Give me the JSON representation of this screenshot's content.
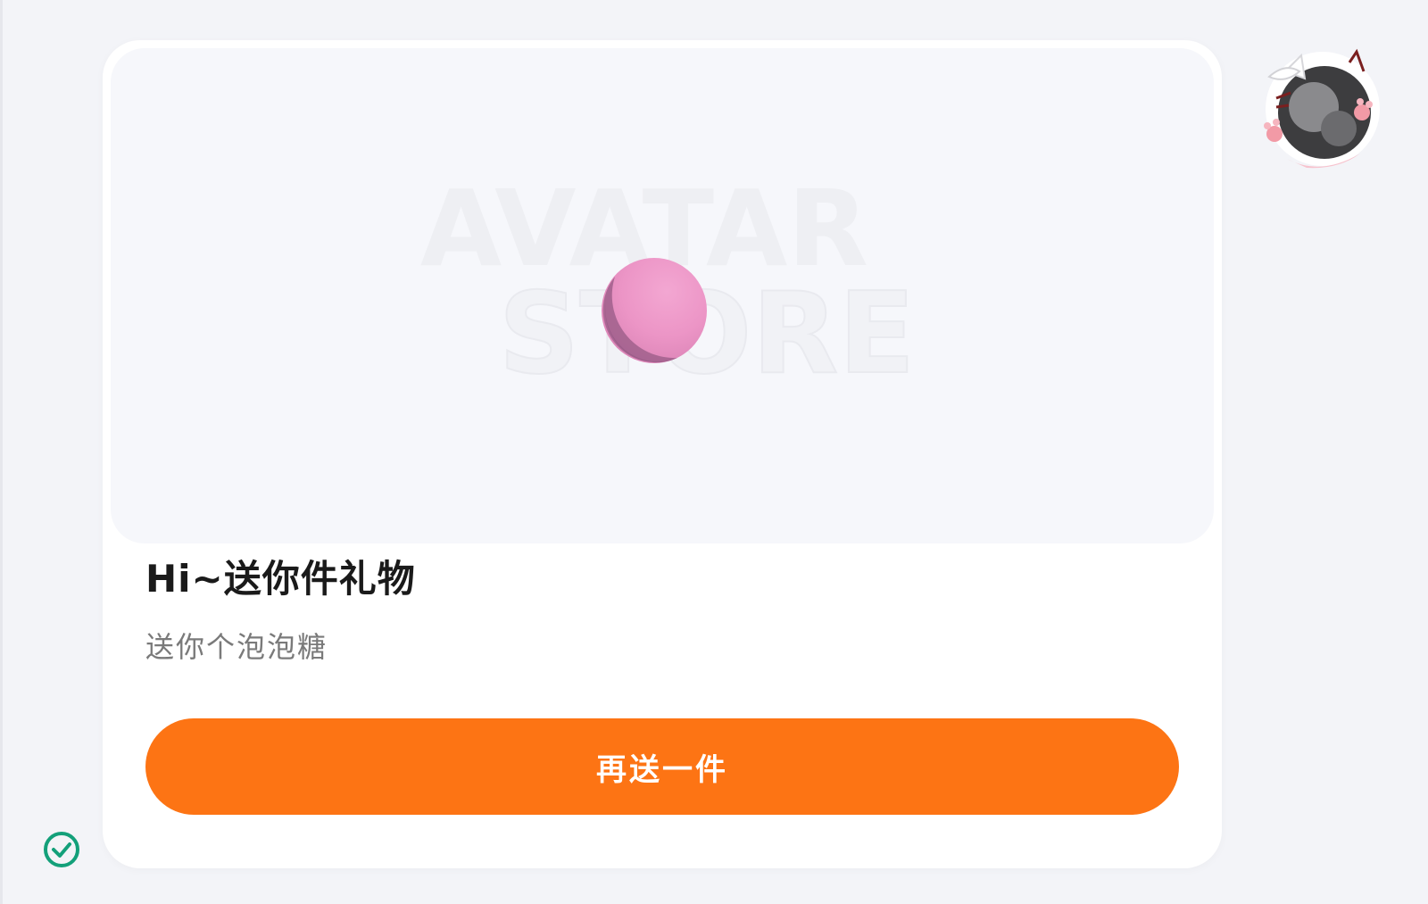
{
  "preview": {
    "watermark_line1": "AVATAR",
    "watermark_line2": "STORE",
    "gift_icon": "bubble-gum-ball-icon"
  },
  "gift": {
    "title": "Hi~送你件礼物",
    "message": "送你个泡泡糖"
  },
  "actions": {
    "send_again_label": "再送一件"
  },
  "icons": {
    "sticker": "cat-avatar-sticker-icon",
    "status": "check-circle-icon"
  },
  "colors": {
    "accent": "#fd7414",
    "gum": "#ef98c7",
    "check": "#13a07a"
  }
}
